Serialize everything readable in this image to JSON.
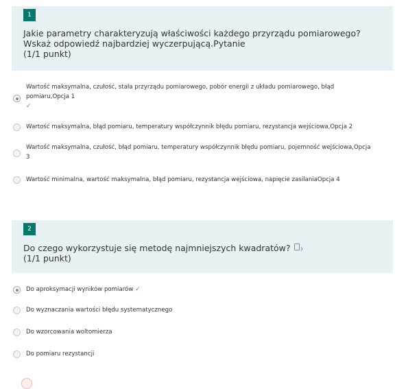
{
  "questions": [
    {
      "number": "1",
      "text": "Jakie parametry charakteryzują właściwości każdego przyrządu pomiarowego? Wskaż odpowiedź najbardziej wyczerpującą.Pytanie",
      "points": "(1/1 punkt)",
      "options": [
        {
          "label": "Wartość maksymalna, czułość, stała przyrządu pomiarowego, pobór energii z układu pomiarowego, błąd pomiaru,Opcja 1",
          "selected": true,
          "correct": true
        },
        {
          "label": "Wartość maksymalna, błąd pomiaru, temperatury współczynnik błędu pomiaru, rezystancja wejściowa,Opcja 2",
          "selected": false
        },
        {
          "label": "Wartość maksymalna, czułość, błąd pomiaru, temperatury współczynnik błędu pomiaru, pojemność wejściowa,Opcja 3",
          "selected": false
        },
        {
          "label": "Wartość minimalna, wartość maksymalna, błąd pomiaru, rezystancja wejściowa, napięcie zasilaniaOpcja 4",
          "selected": false
        }
      ]
    },
    {
      "number": "2",
      "text": "Do czego wykorzystuje się metodę najmniejszych kwadratów?",
      "points": "(1/1 punkt)",
      "icon": "immersive-reader-icon",
      "options": [
        {
          "label": "Do aproksymacji wyników pomiarów",
          "selected": true,
          "correct": true
        },
        {
          "label": "Do wyznaczania wartości błędu systematycznego",
          "selected": false
        },
        {
          "label": "Do wzorcowania woltomierza",
          "selected": false
        },
        {
          "label": "Do pomiaru rezystancji",
          "selected": false
        }
      ]
    }
  ],
  "check_symbol": "✓",
  "colors": {
    "accent": "#05796b",
    "header_bg": "#e8f1f3",
    "check": "#3aa37a"
  }
}
